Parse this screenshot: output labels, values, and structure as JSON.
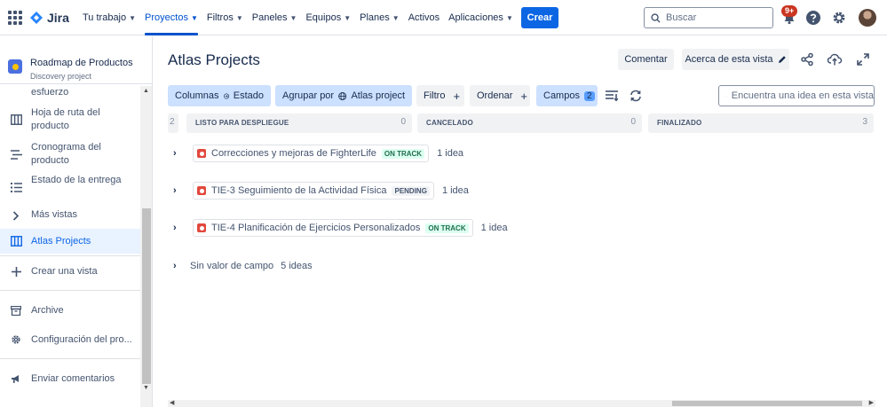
{
  "topnav": {
    "brand": "Jira",
    "items": [
      {
        "label": "Tu trabajo",
        "dropdown": true
      },
      {
        "label": "Proyectos",
        "dropdown": true,
        "active": true
      },
      {
        "label": "Filtros",
        "dropdown": true
      },
      {
        "label": "Paneles",
        "dropdown": true
      },
      {
        "label": "Equipos",
        "dropdown": true
      },
      {
        "label": "Planes",
        "dropdown": true
      },
      {
        "label": "Activos",
        "dropdown": false
      },
      {
        "label": "Aplicaciones",
        "dropdown": true
      }
    ],
    "create_label": "Crear",
    "search_placeholder": "Buscar",
    "notifications_badge": "9+",
    "accent_color": "#0c66e4"
  },
  "sidebar": {
    "project_name": "Roadmap de Productos",
    "project_type": "Discovery project",
    "items": [
      {
        "label": "esfuerzo",
        "icon": "truncated"
      },
      {
        "label": "Hoja de ruta del producto",
        "icon": "board-icon"
      },
      {
        "label": "Cronograma del producto",
        "icon": "timeline-icon"
      },
      {
        "label": "Estado de la entrega",
        "icon": "list-icon"
      },
      {
        "label": "Más vistas",
        "icon": "chevron-right-icon"
      },
      {
        "label": "Atlas Projects",
        "icon": "board-icon",
        "selected": true
      },
      {
        "label": "Crear una vista",
        "icon": "plus-icon"
      },
      {
        "label": "Archive",
        "icon": "archive-icon"
      },
      {
        "label": "Configuración del pro...",
        "icon": "gear-icon"
      },
      {
        "label": "Enviar comentarios",
        "icon": "megaphone-icon"
      }
    ]
  },
  "main": {
    "title": "Atlas Projects",
    "comment_label": "Comentar",
    "about_label": "Acerca de esta vista",
    "toolbar": {
      "columns_label": "Columnas",
      "columns_value": "Estado",
      "group_label": "Agrupar por",
      "group_value": "Atlas project",
      "filter_label": "Filtro",
      "sort_label": "Ordenar",
      "fields_label": "Campos",
      "fields_count": "2",
      "search_placeholder": "Encuentra una idea en esta vista"
    },
    "columns": [
      {
        "leading_count": "2",
        "name": "LISTO PARA DESPLIEGUE",
        "count": "0"
      },
      {
        "name": "CANCELADO",
        "count": "0"
      },
      {
        "name": "FINALIZADO",
        "count": "3"
      }
    ],
    "groups": [
      {
        "title": "Correcciones y mejoras de FighterLife",
        "status": "ON TRACK",
        "status_color": "green",
        "count": "1 idea"
      },
      {
        "title": "TIE-3 Seguimiento de la Actividad Física",
        "status": "PENDING",
        "status_color": "gray",
        "count": "1 idea"
      },
      {
        "title": "TIE-4 Planificación de Ejercicios Personalizados",
        "status": "ON TRACK",
        "status_color": "green",
        "count": "1 idea"
      }
    ],
    "no_value_group": {
      "label": "Sin valor de campo",
      "count": "5 ideas"
    }
  }
}
